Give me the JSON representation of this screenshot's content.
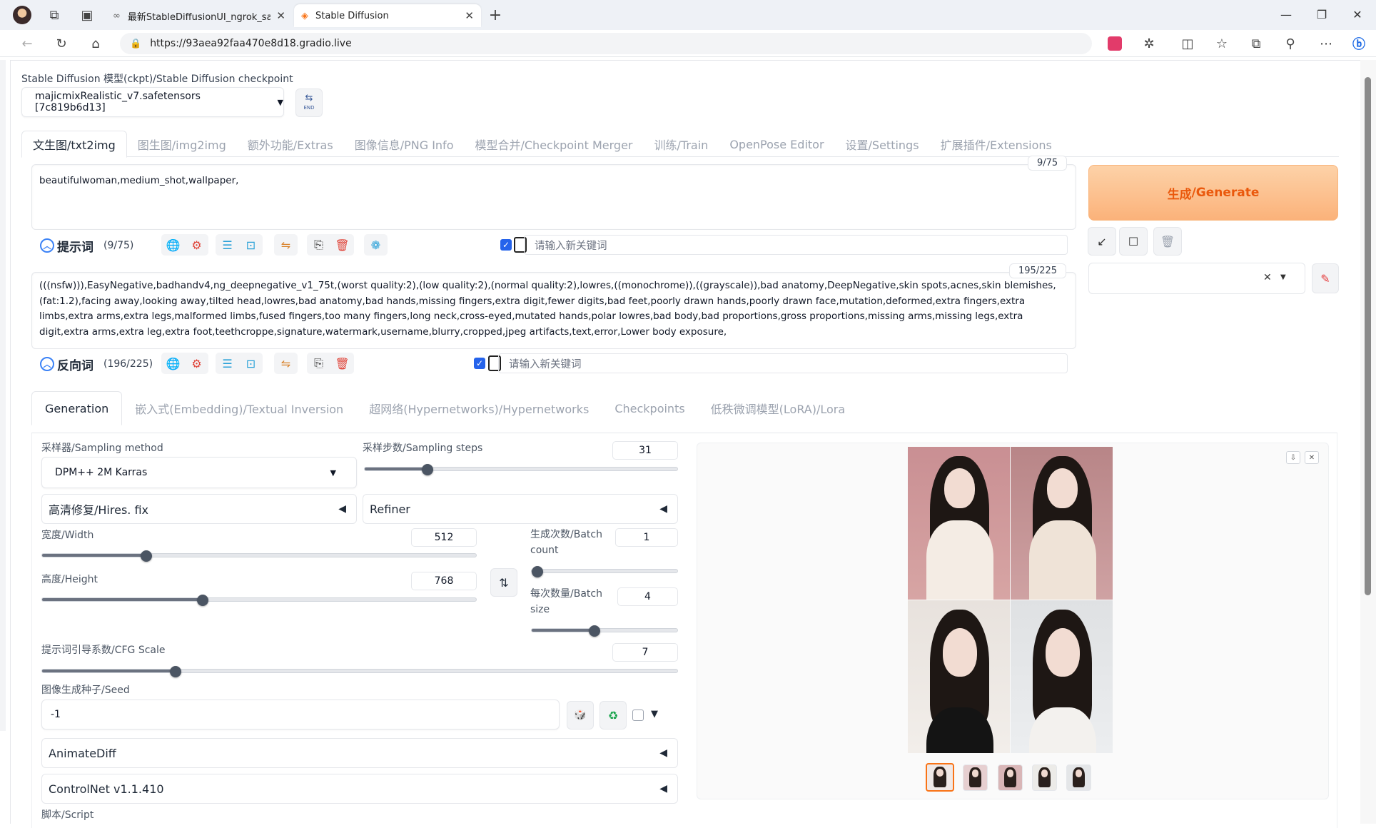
{
  "browser": {
    "tabs": [
      {
        "title": "最新StableDiffusionUI_ngrok_sag"
      },
      {
        "title": "Stable Diffusion"
      }
    ],
    "url": "https://93aea92faa470e8d18.gradio.live",
    "new_tab": "+",
    "close": "✕"
  },
  "checkpoint": {
    "label": "Stable Diffusion 模型(ckpt)/Stable Diffusion checkpoint",
    "value": "majicmixRealistic_v7.safetensors [7c819b6d13]"
  },
  "main_tabs": [
    {
      "label": "文生图/txt2img"
    },
    {
      "label": "图生图/img2img"
    },
    {
      "label": "额外功能/Extras"
    },
    {
      "label": "图像信息/PNG Info"
    },
    {
      "label": "模型合并/Checkpoint Merger"
    },
    {
      "label": "训练/Train"
    },
    {
      "label": "OpenPose Editor"
    },
    {
      "label": "设置/Settings"
    },
    {
      "label": "扩展插件/Extensions"
    }
  ],
  "prompt": {
    "text": "beautifulwoman,medium_shot,wallpaper,",
    "token_count": "9/75",
    "title": "提示词",
    "count": "(9/75)",
    "keyword_placeholder": "请输入新关键词"
  },
  "negative": {
    "text": "(((nsfw))),EasyNegative,badhandv4,ng_deepnegative_v1_75t,(worst quality:2),(low quality:2),(normal quality:2),lowres,((monochrome)),((grayscale)),bad anatomy,DeepNegative,skin spots,acnes,skin blemishes,(fat:1.2),facing away,looking away,tilted head,lowres,bad anatomy,bad hands,missing fingers,extra digit,fewer digits,bad feet,poorly drawn hands,poorly drawn face,mutation,deformed,extra fingers,extra limbs,extra arms,extra legs,malformed limbs,fused fingers,too many fingers,long neck,cross-eyed,mutated hands,polar lowres,bad body,bad proportions,gross proportions,missing arms,missing legs,extra digit,extra arms,extra leg,extra foot,teethcroppe,signature,watermark,username,blurry,cropped,jpeg artifacts,text,error,Lower body exposure,",
    "token_count": "195/225",
    "title": "反向词",
    "count": "(196/225)",
    "keyword_placeholder": "请输入新关键词"
  },
  "generate": {
    "label_cn": "生成",
    "label_en": "/Generate"
  },
  "sub_tabs": [
    {
      "label": "Generation"
    },
    {
      "label": "嵌入式(Embedding)/Textual Inversion"
    },
    {
      "label": "超网络(Hypernetworks)/Hypernetworks"
    },
    {
      "label": "Checkpoints"
    },
    {
      "label": "低秩微调模型(LoRA)/Lora"
    }
  ],
  "sampling": {
    "method_label": "采样器/Sampling method",
    "method_value": "DPM++ 2M Karras",
    "steps_label": "采样步数/Sampling steps",
    "steps_value": "31",
    "steps_fraction": 0.2
  },
  "hires": {
    "label": "高清修复/Hires. fix"
  },
  "refiner": {
    "label": "Refiner"
  },
  "width": {
    "label": "宽度/Width",
    "value": "512",
    "fraction": 0.24
  },
  "height": {
    "label": "高度/Height",
    "value": "768",
    "fraction": 0.37
  },
  "batch_count": {
    "label_line1": "生成次数/Batch",
    "label_line2": "count",
    "value": "1",
    "fraction": 0.0
  },
  "batch_size": {
    "label_line1": "每次数量/Batch",
    "label_line2": "size",
    "value": "4",
    "fraction": 0.43
  },
  "cfg": {
    "label": "提示词引导系数/CFG Scale",
    "value": "7",
    "fraction": 0.21
  },
  "seed": {
    "label": "图像生成种子/Seed",
    "value": "-1"
  },
  "accordions": {
    "animatediff": "AnimateDiff",
    "controlnet": "ControlNet v1.1.410"
  },
  "script": {
    "label": "脚本/Script"
  },
  "icons": {
    "triangle_left": "◀",
    "caret_down": "▼",
    "swap": "⇅",
    "recycle": "♻",
    "dice": "🎲",
    "close": "✕"
  },
  "colors": {
    "accent_orange": "#ea580c",
    "checkbox_blue": "#2563eb",
    "tool_red": "#e0453a",
    "tool_blue": "#2aa1d8"
  }
}
